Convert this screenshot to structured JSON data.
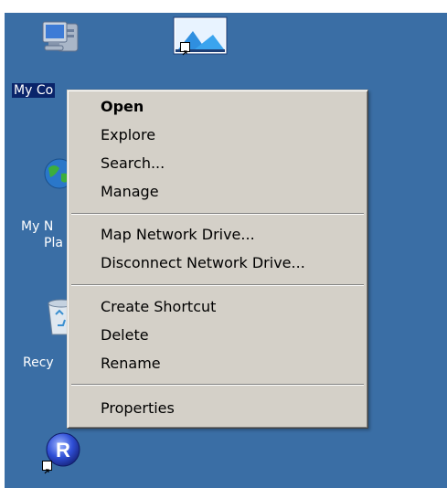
{
  "desktop": {
    "background_color": "#3a6ea5",
    "icons": {
      "my_computer": {
        "label": "My Co",
        "icon": "my-computer-icon"
      },
      "shortcut_top": {
        "icon": "image-shortcut-icon"
      },
      "my_network_places": {
        "label_line1": "My N",
        "label_line2": "Pla",
        "icon": "globe-icon"
      },
      "recycle_bin": {
        "label": "Recy",
        "icon": "recycle-bin-icon"
      },
      "r_shortcut": {
        "letter": "R",
        "icon": "r-app-icon"
      }
    }
  },
  "context_menu": {
    "items": [
      {
        "label": "Open"
      },
      {
        "label": "Explore"
      },
      {
        "label": "Search..."
      },
      {
        "label": "Manage"
      },
      {
        "label": "Map Network Drive..."
      },
      {
        "label": "Disconnect Network Drive..."
      },
      {
        "label": "Create Shortcut"
      },
      {
        "label": "Delete"
      },
      {
        "label": "Rename"
      },
      {
        "label": "Properties"
      }
    ]
  }
}
